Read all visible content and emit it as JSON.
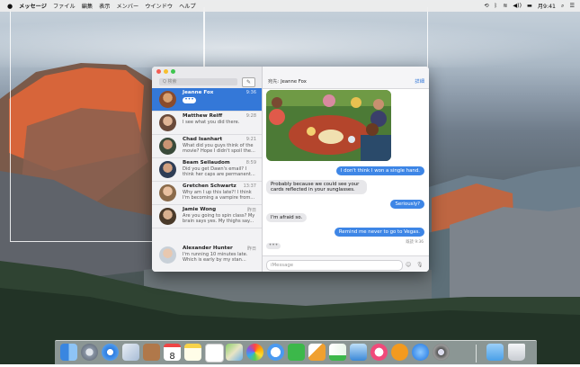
{
  "menubar": {
    "apple": "",
    "items": [
      "メッセージ",
      "ファイル",
      "編集",
      "表示",
      "メンバー",
      "ウインドウ",
      "ヘルプ"
    ],
    "clock": "月9:41"
  },
  "sidebar": {
    "search_placeholder": "Q 検索",
    "conversations": [
      {
        "name": "Jeanne Fox",
        "time": "9:36",
        "preview": "",
        "typing": true,
        "selected": true
      },
      {
        "name": "Matthew Reiff",
        "time": "9:28",
        "preview": "I see what you did there.",
        "typing": false,
        "selected": false
      },
      {
        "name": "Chad Isanhart",
        "time": "9:21",
        "preview": "What did you guys think of the movie? Hope I didn't spoil the...",
        "typing": false,
        "selected": false
      },
      {
        "name": "Beam Seilaudom",
        "time": "8:59",
        "preview": "Did you get Dawn's email? I think her caps are permanent...",
        "typing": false,
        "selected": false
      },
      {
        "name": "Gretchen Schwartz",
        "time": "13:37",
        "preview": "Why am I up this late?! I think I'm becoming a vampire from...",
        "typing": false,
        "selected": false
      },
      {
        "name": "Jamie Wong",
        "time": "昨日",
        "preview": "Are you going to spin class? My brain says yes. My thighs say...",
        "typing": false,
        "selected": false
      },
      {
        "name": "Alexander Hunter",
        "time": "昨日",
        "preview": "I'm running 10 minutes late. Which is early by my stan...",
        "typing": false,
        "selected": false
      }
    ]
  },
  "chat": {
    "to_label": "宛先:",
    "to_name": "Jeanne Fox",
    "details": "詳細",
    "messages": [
      {
        "from": "me",
        "text": "I don't think I won a single hand."
      },
      {
        "from": "them",
        "text": "Probably because we could see your cards reflected in your sunglasses."
      },
      {
        "from": "me",
        "text": "Seriously?"
      },
      {
        "from": "them",
        "text": "I'm afraid so."
      },
      {
        "from": "me",
        "text": "Remind me never to go to Vegas."
      }
    ],
    "read_receipt": "既読 9:36",
    "input_placeholder": "iMessage"
  },
  "dock": {
    "icons": [
      "finder-icon",
      "launchpad-icon",
      "safari-icon",
      "mail-icon",
      "contacts-icon",
      "calendar-icon",
      "notes-icon",
      "reminders-icon",
      "maps-icon",
      "photos-icon",
      "messages-icon",
      "facetime-icon",
      "pages-icon",
      "numbers-icon",
      "keynote-icon",
      "itunes-icon",
      "ibooks-icon",
      "app-store-icon",
      "system-preferences-icon",
      "downloads-folder-icon",
      "trash-icon"
    ],
    "calendar_day": "8"
  }
}
